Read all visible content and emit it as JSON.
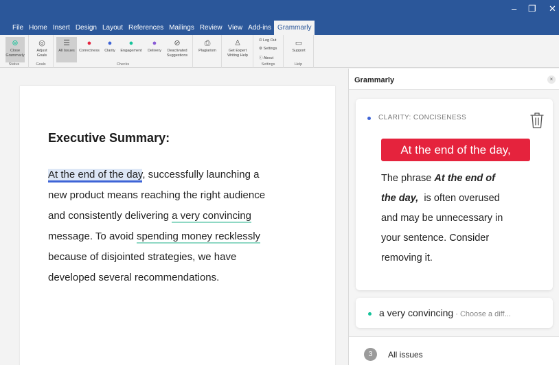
{
  "window": {
    "controls": {
      "minimize": "–",
      "maximize": "❐",
      "close": "✕"
    }
  },
  "menu": {
    "tabs": [
      "File",
      "Home",
      "Insert",
      "Design",
      "Layout",
      "References",
      "Mailings",
      "Review",
      "View",
      "Add-ins",
      "Grammarly"
    ],
    "active_tab": "Grammarly"
  },
  "ribbon": {
    "status": {
      "button": [
        "Close",
        "Grammarly"
      ],
      "label": "Status"
    },
    "goals": {
      "button": [
        "Adjust",
        "Goals"
      ],
      "label": "Goals"
    },
    "checks": {
      "buttons": [
        "All Issues",
        "Correctness",
        "Clarity",
        "Engagement",
        "Delivery"
      ],
      "deactivated": [
        "Deactivated",
        "Suggestions"
      ],
      "label": "Checks"
    },
    "plagiarism": "Plagiarism",
    "expert": [
      "Get Expert",
      "Writing Help"
    ],
    "settings": {
      "items": [
        "Log Out",
        "Settings",
        "About"
      ],
      "label": "Settings"
    },
    "help": {
      "button": "Support",
      "label": "Help"
    }
  },
  "document": {
    "heading": "Executive Summary:",
    "lines": [
      {
        "pre": "",
        "flag": "At the end of the day",
        "post": ", successfully launching a"
      },
      {
        "text": "new product means reaching the right audience"
      },
      {
        "pre": "and consistently delivering ",
        "flag": "a very convincing",
        "post": ""
      },
      {
        "pre": "message. To avoid ",
        "flag": "spending money recklessly",
        "post": ""
      },
      {
        "text": "because of disjointed strategies, we have"
      },
      {
        "text": "developed several recommendations."
      }
    ]
  },
  "grammarly": {
    "pane_title": "Grammarly",
    "close_glyph": "×",
    "card": {
      "category": "CLARITY: CONCISENESS",
      "replacement": "At the end of the day,",
      "explanation": {
        "l1_pre": "The phrase ",
        "l1_bold": "At the end of",
        "l2_bold": "the day,",
        "l2_post": "  is often overused",
        "l3": "and may be unnecessary in",
        "l4": "your sentence. Consider",
        "l5": "removing it."
      }
    },
    "card2": {
      "text": "a very convincing",
      "hint": " · Choose a diff..."
    },
    "footer": {
      "count": "3",
      "label": "All issues"
    }
  },
  "colors": {
    "title_bar": "#2b579a",
    "critical_red": "#e5233d",
    "clarity_blue": "#3e64d6",
    "engagement_green": "#15c39a"
  }
}
